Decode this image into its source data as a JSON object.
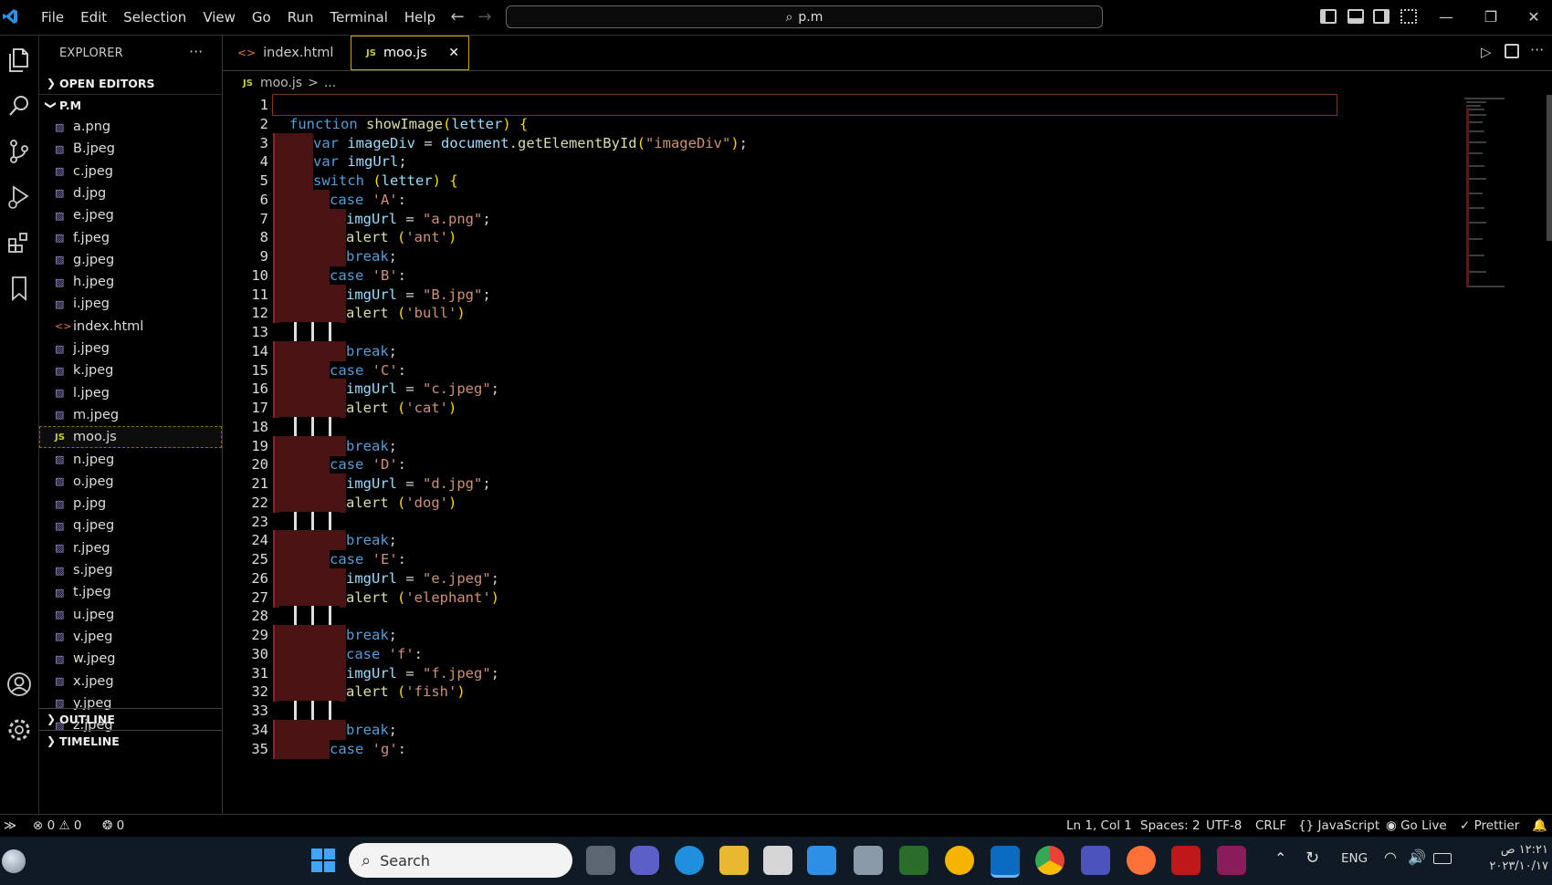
{
  "menu": [
    "File",
    "Edit",
    "Selection",
    "View",
    "Go",
    "Run",
    "Terminal",
    "Help"
  ],
  "search": {
    "text": "p.m"
  },
  "explorer": {
    "title": "EXPLORER",
    "more": "···",
    "open_editors": "OPEN EDITORS",
    "folder": "P.M",
    "files": [
      {
        "name": "a.png",
        "type": "img"
      },
      {
        "name": "B.jpeg",
        "type": "img"
      },
      {
        "name": "c.jpeg",
        "type": "img"
      },
      {
        "name": "d.jpg",
        "type": "img"
      },
      {
        "name": "e.jpeg",
        "type": "img"
      },
      {
        "name": "f.jpeg",
        "type": "img"
      },
      {
        "name": "g.jpeg",
        "type": "img"
      },
      {
        "name": "h.jpeg",
        "type": "img"
      },
      {
        "name": "i.jpeg",
        "type": "img"
      },
      {
        "name": "index.html",
        "type": "html"
      },
      {
        "name": "j.jpeg",
        "type": "img"
      },
      {
        "name": "k.jpeg",
        "type": "img"
      },
      {
        "name": "l.jpeg",
        "type": "img"
      },
      {
        "name": "m.jpeg",
        "type": "img"
      },
      {
        "name": "moo.js",
        "type": "js",
        "active": true
      },
      {
        "name": "n.jpeg",
        "type": "img"
      },
      {
        "name": "o.jpeg",
        "type": "img"
      },
      {
        "name": "p.jpg",
        "type": "img"
      },
      {
        "name": "q.jpeg",
        "type": "img"
      },
      {
        "name": "r.jpeg",
        "type": "img"
      },
      {
        "name": "s.jpeg",
        "type": "img"
      },
      {
        "name": "t.jpeg",
        "type": "img"
      },
      {
        "name": "u.jpeg",
        "type": "img"
      },
      {
        "name": "v.jpeg",
        "type": "img"
      },
      {
        "name": "w.jpeg",
        "type": "img"
      },
      {
        "name": "x.jpeg",
        "type": "img"
      },
      {
        "name": "y.jpeg",
        "type": "img"
      },
      {
        "name": "z.jpeg",
        "type": "img"
      }
    ],
    "outline": "OUTLINE",
    "timeline": "TIMELINE"
  },
  "tabs": [
    {
      "label": "index.html",
      "icon": "<>",
      "active": false
    },
    {
      "label": "moo.js",
      "icon": "JS",
      "active": true
    }
  ],
  "breadcrumb": {
    "icon": "JS",
    "file": "moo.js",
    "sep": ">",
    "rest": "..."
  },
  "code_lines": [
    {
      "n": 1,
      "indent": 0,
      "tokens": []
    },
    {
      "n": 2,
      "indent": 0,
      "tokens": [
        [
          "kw",
          "function "
        ],
        [
          "fn",
          "showImage"
        ],
        [
          "br",
          "("
        ],
        [
          "var",
          "letter"
        ],
        [
          "br",
          ")"
        ],
        [
          "pl",
          " "
        ],
        [
          "br",
          "{"
        ]
      ]
    },
    {
      "n": 3,
      "indent": 1,
      "tokens": [
        [
          "kw",
          "var "
        ],
        [
          "var",
          "imageDiv"
        ],
        [
          "pl",
          " = "
        ],
        [
          "var",
          "document"
        ],
        [
          "pl",
          "."
        ],
        [
          "fn",
          "getElementById"
        ],
        [
          "br",
          "("
        ],
        [
          "str",
          "\"imageDiv\""
        ],
        [
          "br",
          ")"
        ],
        [
          "pl",
          ";"
        ]
      ]
    },
    {
      "n": 4,
      "indent": 1,
      "tokens": [
        [
          "kw",
          "var "
        ],
        [
          "var",
          "imgUrl"
        ],
        [
          "pl",
          ";"
        ]
      ]
    },
    {
      "n": 5,
      "indent": 1,
      "tokens": [
        [
          "kw",
          "switch "
        ],
        [
          "br",
          "("
        ],
        [
          "var",
          "letter"
        ],
        [
          "br",
          ")"
        ],
        [
          "pl",
          " "
        ],
        [
          "br",
          "{"
        ]
      ]
    },
    {
      "n": 6,
      "indent": 2,
      "tokens": [
        [
          "kw",
          "case "
        ],
        [
          "str",
          "'A'"
        ],
        [
          "pl",
          ":"
        ]
      ]
    },
    {
      "n": 7,
      "indent": 3,
      "tokens": [
        [
          "var",
          "imgUrl"
        ],
        [
          "pl",
          " = "
        ],
        [
          "str",
          "\"a.png\""
        ],
        [
          "pl",
          ";"
        ]
      ]
    },
    {
      "n": 8,
      "indent": 3,
      "tokens": [
        [
          "fn",
          "alert "
        ],
        [
          "br",
          "("
        ],
        [
          "str",
          "'ant'"
        ],
        [
          "br",
          ")"
        ]
      ]
    },
    {
      "n": 9,
      "indent": 3,
      "tokens": [
        [
          "kw",
          "break"
        ],
        [
          "pl",
          ";"
        ]
      ]
    },
    {
      "n": 10,
      "indent": 2,
      "tokens": [
        [
          "kw",
          "case "
        ],
        [
          "str",
          "'B'"
        ],
        [
          "pl",
          ":"
        ]
      ]
    },
    {
      "n": 11,
      "indent": 3,
      "tokens": [
        [
          "var",
          "imgUrl"
        ],
        [
          "pl",
          " = "
        ],
        [
          "str",
          "\"B.jpg\""
        ],
        [
          "pl",
          ";"
        ]
      ]
    },
    {
      "n": 12,
      "indent": 3,
      "tokens": [
        [
          "fn",
          "alert "
        ],
        [
          "br",
          "("
        ],
        [
          "str",
          "'bull'"
        ],
        [
          "br",
          ")"
        ]
      ]
    },
    {
      "n": 13,
      "indent": -1,
      "tokens": []
    },
    {
      "n": 14,
      "indent": 3,
      "tokens": [
        [
          "kw",
          "break"
        ],
        [
          "pl",
          ";"
        ]
      ]
    },
    {
      "n": 15,
      "indent": 2,
      "tokens": [
        [
          "kw",
          "case "
        ],
        [
          "str",
          "'C'"
        ],
        [
          "pl",
          ":"
        ]
      ]
    },
    {
      "n": 16,
      "indent": 3,
      "tokens": [
        [
          "var",
          "imgUrl"
        ],
        [
          "pl",
          " = "
        ],
        [
          "str",
          "\"c.jpeg\""
        ],
        [
          "pl",
          ";"
        ]
      ]
    },
    {
      "n": 17,
      "indent": 3,
      "tokens": [
        [
          "fn",
          "alert "
        ],
        [
          "br",
          "("
        ],
        [
          "str",
          "'cat'"
        ],
        [
          "br",
          ")"
        ]
      ]
    },
    {
      "n": 18,
      "indent": -1,
      "tokens": []
    },
    {
      "n": 19,
      "indent": 3,
      "tokens": [
        [
          "kw",
          "break"
        ],
        [
          "pl",
          ";"
        ]
      ]
    },
    {
      "n": 20,
      "indent": 2,
      "tokens": [
        [
          "kw",
          "case "
        ],
        [
          "str",
          "'D'"
        ],
        [
          "pl",
          ":"
        ]
      ]
    },
    {
      "n": 21,
      "indent": 3,
      "tokens": [
        [
          "var",
          "imgUrl"
        ],
        [
          "pl",
          " = "
        ],
        [
          "str",
          "\"d.jpg\""
        ],
        [
          "pl",
          ";"
        ]
      ]
    },
    {
      "n": 22,
      "indent": 3,
      "tokens": [
        [
          "fn",
          "alert "
        ],
        [
          "br",
          "("
        ],
        [
          "str",
          "'dog'"
        ],
        [
          "br",
          ")"
        ]
      ]
    },
    {
      "n": 23,
      "indent": -1,
      "tokens": []
    },
    {
      "n": 24,
      "indent": 3,
      "tokens": [
        [
          "kw",
          "break"
        ],
        [
          "pl",
          ";"
        ]
      ]
    },
    {
      "n": 25,
      "indent": 2,
      "tokens": [
        [
          "kw",
          "case "
        ],
        [
          "str",
          "'E'"
        ],
        [
          "pl",
          ":"
        ]
      ]
    },
    {
      "n": 26,
      "indent": 3,
      "tokens": [
        [
          "var",
          "imgUrl"
        ],
        [
          "pl",
          " = "
        ],
        [
          "str",
          "\"e.jpeg\""
        ],
        [
          "pl",
          ";"
        ]
      ]
    },
    {
      "n": 27,
      "indent": 3,
      "tokens": [
        [
          "fn",
          "alert "
        ],
        [
          "br",
          "("
        ],
        [
          "str",
          "'elephant'"
        ],
        [
          "br",
          ")"
        ]
      ]
    },
    {
      "n": 28,
      "indent": -1,
      "tokens": []
    },
    {
      "n": 29,
      "indent": 3,
      "tokens": [
        [
          "kw",
          "break"
        ],
        [
          "pl",
          ";"
        ]
      ]
    },
    {
      "n": 30,
      "indent": 3,
      "tokens": [
        [
          "kw",
          "case "
        ],
        [
          "str",
          "'f'"
        ],
        [
          "pl",
          ":"
        ]
      ]
    },
    {
      "n": 31,
      "indent": 3,
      "tokens": [
        [
          "var",
          "imgUrl"
        ],
        [
          "pl",
          " = "
        ],
        [
          "str",
          "\"f.jpeg\""
        ],
        [
          "pl",
          ";"
        ]
      ]
    },
    {
      "n": 32,
      "indent": 3,
      "tokens": [
        [
          "fn",
          "alert "
        ],
        [
          "br",
          "("
        ],
        [
          "str",
          "'fish'"
        ],
        [
          "br",
          ")"
        ]
      ]
    },
    {
      "n": 33,
      "indent": -1,
      "tokens": []
    },
    {
      "n": 34,
      "indent": 3,
      "tokens": [
        [
          "kw",
          "break"
        ],
        [
          "pl",
          ";"
        ]
      ]
    },
    {
      "n": 35,
      "indent": 2,
      "tokens": [
        [
          "kw",
          "case "
        ],
        [
          "str",
          "'g'"
        ],
        [
          "pl",
          ":"
        ]
      ]
    }
  ],
  "status": {
    "errors": "0",
    "warnings": "0",
    "ports": "0",
    "position": "Ln 1, Col 1",
    "spaces": "Spaces: 2",
    "encoding": "UTF-8",
    "eol": "CRLF",
    "language": "JavaScript",
    "golive": "Go Live",
    "prettier": "Prettier"
  },
  "taskbar": {
    "search": "Search",
    "lang": "ENG",
    "time": "١٢:٢١ ص",
    "date": "٢٠٢٣/١٠/١٧"
  },
  "colors": {
    "accent": "#c8a416",
    "guide": "#4b1414",
    "taskbar": "#101a24"
  }
}
